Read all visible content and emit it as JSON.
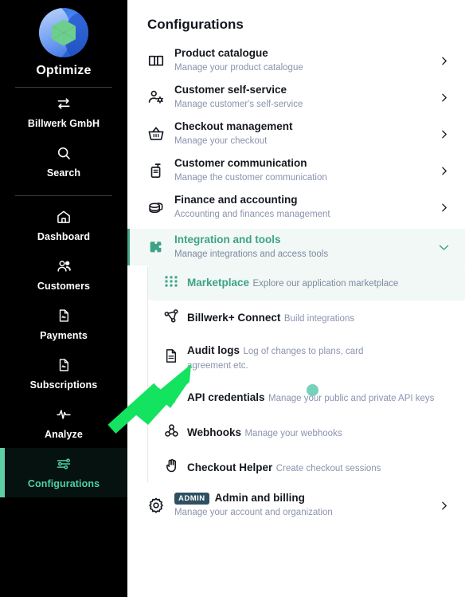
{
  "sidebar": {
    "brand": {
      "name": "Optimize",
      "logo_icon": "optimize-logo"
    },
    "org": {
      "label": "Billwerk GmbH",
      "icon": "switch-arrows-icon"
    },
    "search": {
      "label": "Search",
      "icon": "search-icon"
    },
    "items": [
      {
        "label": "Dashboard",
        "icon": "home-icon",
        "active": false
      },
      {
        "label": "Customers",
        "icon": "users-icon",
        "active": false
      },
      {
        "label": "Payments",
        "icon": "document-icon",
        "active": false
      },
      {
        "label": "Subscriptions",
        "icon": "document-icon",
        "active": false
      },
      {
        "label": "Analyze",
        "icon": "pulse-icon",
        "active": false
      },
      {
        "label": "Configurations",
        "icon": "sliders-icon",
        "active": true
      }
    ]
  },
  "main": {
    "title": "Configurations",
    "rows": [
      {
        "title": "Product catalogue",
        "subtitle": "Manage your product catalogue",
        "icon": "book-icon",
        "chevron": "chevron-right-icon"
      },
      {
        "title": "Customer self-service",
        "subtitle": "Manage customer's self-service",
        "icon": "user-gear-icon",
        "chevron": "chevron-right-icon"
      },
      {
        "title": "Checkout management",
        "subtitle": "Manage your checkout",
        "icon": "basket-icon",
        "chevron": "chevron-right-icon"
      },
      {
        "title": "Customer communication",
        "subtitle": "Manage the customer communication",
        "icon": "radio-icon",
        "chevron": "chevron-right-icon"
      },
      {
        "title": "Finance and accounting",
        "subtitle": "Accounting and finances management",
        "icon": "coins-icon",
        "chevron": "chevron-right-icon"
      }
    ],
    "expanded_row": {
      "title": "Integration and tools",
      "subtitle": "Manage integrations and access tools",
      "icon": "puzzle-icon",
      "chevron": "chevron-down-icon"
    },
    "sub_rows": [
      {
        "title": "Marketplace",
        "subtitle": "Explore our application marketplace",
        "icon": "grid-dots-icon",
        "selected": true
      },
      {
        "title": "Billwerk+ Connect",
        "subtitle": "Build integrations",
        "icon": "share-nodes-icon",
        "selected": false
      },
      {
        "title": "Audit logs",
        "subtitle": "Log of changes to plans, card agreement etc.",
        "icon": "file-lines-icon",
        "selected": false
      },
      {
        "title": "API credentials",
        "subtitle": "Manage your public and private API keys",
        "icon": "key-icon",
        "selected": false
      },
      {
        "title": "Webhooks",
        "subtitle": "Manage your webhooks",
        "icon": "webhook-icon",
        "selected": false
      },
      {
        "title": "Checkout Helper",
        "subtitle": "Create checkout sessions",
        "icon": "hand-icon",
        "selected": false
      }
    ],
    "admin_row": {
      "badge": "ADMIN",
      "title": "Admin and billing",
      "subtitle": "Manage your account and organization",
      "icon": "gear-icon",
      "chevron": "chevron-right-icon"
    }
  },
  "annotation": {
    "arrow_icon": "green-arrow-pointer",
    "cursor_dot_icon": "click-dot-icon"
  },
  "colors": {
    "accent_green": "#3ea287",
    "sidebar_active_green": "#4ed0a8",
    "sidebar_bg": "#000000",
    "subtitle": "#8b93ad",
    "badge_bg": "#2f5062",
    "annotation_green": "#13e35f"
  }
}
